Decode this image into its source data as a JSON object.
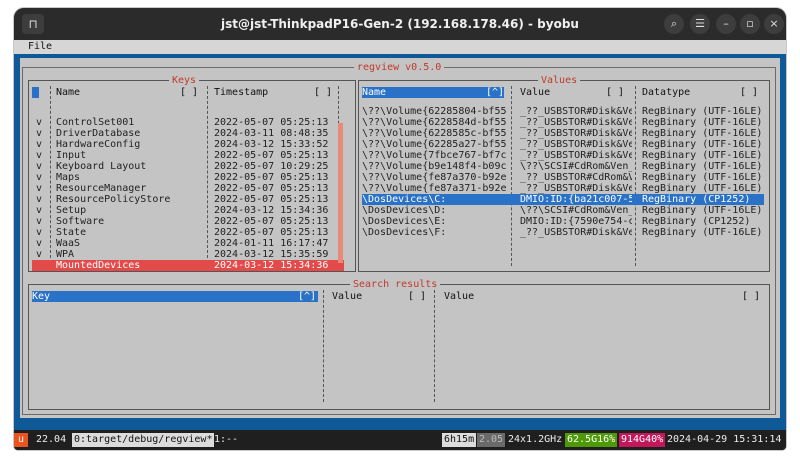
{
  "window": {
    "title": "jst@jst-ThinkpadP16-Gen-2 (192.168.178.46) - byobu",
    "left_glyph": "⊓",
    "buttons": {
      "search": "⌕",
      "menu": "☰",
      "minimize": "–",
      "maximize": "▫",
      "close": "×"
    }
  },
  "menubar": {
    "file": "File"
  },
  "app": {
    "title": "regview v0.5.0"
  },
  "keys": {
    "title": "Keys",
    "col_name": "Name",
    "col_name_box": "[ ]",
    "col_timestamp": "Timestamp",
    "col_timestamp_box": "[ ]",
    "rows": [
      {
        "flag": "v",
        "name": "ControlSet001",
        "ts": "2022-05-07 05:25:13"
      },
      {
        "flag": "v",
        "name": "DriverDatabase",
        "ts": "2024-03-11 08:48:35"
      },
      {
        "flag": "v",
        "name": "HardwareConfig",
        "ts": "2024-03-12 15:33:52"
      },
      {
        "flag": "v",
        "name": "Input",
        "ts": "2022-05-07 05:25:13"
      },
      {
        "flag": "v",
        "name": "Keyboard Layout",
        "ts": "2022-05-07 10:29:25"
      },
      {
        "flag": "v",
        "name": "Maps",
        "ts": "2022-05-07 05:25:13"
      },
      {
        "flag": "v",
        "name": "ResourceManager",
        "ts": "2022-05-07 05:25:13"
      },
      {
        "flag": "v",
        "name": "ResourcePolicyStore",
        "ts": "2022-05-07 05:25:13"
      },
      {
        "flag": "v",
        "name": "Setup",
        "ts": "2024-03-12 15:34:36"
      },
      {
        "flag": "v",
        "name": "Software",
        "ts": "2022-05-07 05:25:13"
      },
      {
        "flag": "v",
        "name": "State",
        "ts": "2022-05-07 05:25:13"
      },
      {
        "flag": "v",
        "name": "WaaS",
        "ts": "2024-01-11 16:17:47"
      },
      {
        "flag": "v",
        "name": "WPA",
        "ts": "2024-03-12 15:35:59"
      },
      {
        "flag": "",
        "name": "MountedDevices",
        "ts": "2024-03-12 15:34:36"
      }
    ]
  },
  "values": {
    "title": "Values",
    "col_name": "Name",
    "col_name_box": "[^]",
    "col_value": "Value",
    "col_value_box": "[ ]",
    "col_datatype": "Datatype",
    "col_datatype_box": "[ ]",
    "rows": [
      {
        "name": "\\??\\Volume{62285804-bf55-",
        "value": "_??_USBSTOR#Disk&Ve",
        "type": "RegBinary (UTF-16LE)"
      },
      {
        "name": "\\??\\Volume{6228584d-bf55-",
        "value": "_??_USBSTOR#Disk&Ve",
        "type": "RegBinary (UTF-16LE)"
      },
      {
        "name": "\\??\\Volume{6228585c-bf55-",
        "value": "_??_USBSTOR#Disk&Ve",
        "type": "RegBinary (UTF-16LE)"
      },
      {
        "name": "\\??\\Volume{62285a27-bf55-",
        "value": "_??_USBSTOR#Disk&Ve",
        "type": "RegBinary (UTF-16LE)"
      },
      {
        "name": "\\??\\Volume{7fbce767-bf7c-",
        "value": "_??_USBSTOR#Disk&Ve",
        "type": "RegBinary (UTF-16LE)"
      },
      {
        "name": "\\??\\Volume{b9e148f4-b09c-",
        "value": "\\??\\SCSI#CdRom&Ven_",
        "type": "RegBinary (UTF-16LE)"
      },
      {
        "name": "\\??\\Volume{fe87a370-b92e-",
        "value": "_??_USBSTOR#CdRom&V",
        "type": "RegBinary (UTF-16LE)"
      },
      {
        "name": "\\??\\Volume{fe87a371-b92e-",
        "value": "_??_USBSTOR#Disk&Ve",
        "type": "RegBinary (UTF-16LE)"
      },
      {
        "name": "\\DosDevices\\C:",
        "value": "DMIO:ID:{ba21c007-5",
        "type": "RegBinary (CP1252)"
      },
      {
        "name": "\\DosDevices\\D:",
        "value": "\\??\\SCSI#CdRom&Ven_",
        "type": "RegBinary (UTF-16LE)"
      },
      {
        "name": "\\DosDevices\\E:",
        "value": "DMIO:ID:{7590e754-c",
        "type": "RegBinary (CP1252)"
      },
      {
        "name": "\\DosDevices\\F:",
        "value": "_??_USBSTOR#Disk&Ve",
        "type": "RegBinary (UTF-16LE)"
      }
    ]
  },
  "search": {
    "title": "Search results",
    "col_key": "Key",
    "col_key_box": "[^]",
    "col_value1": "Value",
    "col_value1_box": "[ ]",
    "col_value2": "Value",
    "col_value2_box": "[ ]"
  },
  "statusbar": {
    "logo": "u",
    "version": "22.04",
    "window_label": "0:target/debug/regview*",
    "window_next": "1:--",
    "uptime": "6h15m",
    "load": "2.05",
    "cpu": "24x1.2GHz",
    "mem_used": "62.5G16%",
    "disk": "914G40%",
    "datetime": "2024-04-29 15:31:14"
  },
  "colors": {
    "selected_key": "#e34b4b",
    "selected_value": "#2a71c8",
    "accent_title": "#c0392b"
  }
}
